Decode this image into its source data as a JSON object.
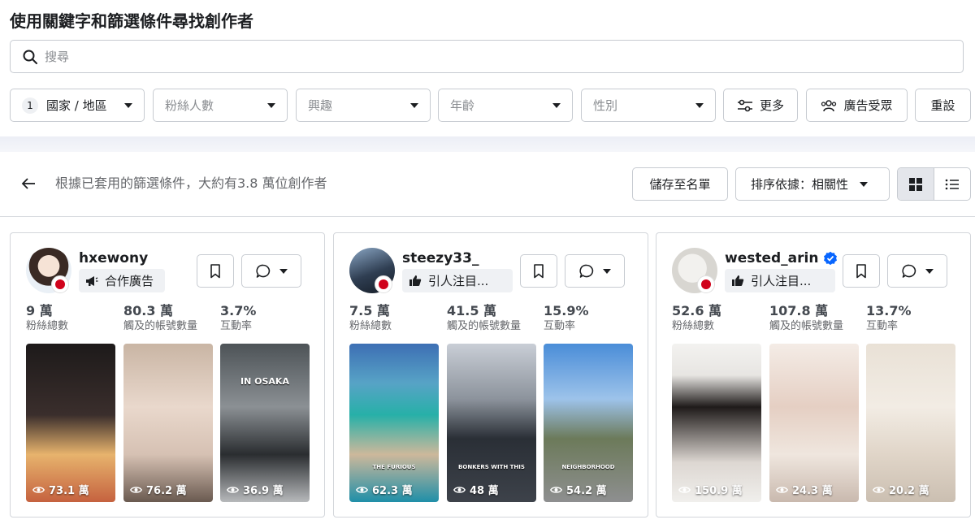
{
  "page": {
    "title": "使用關鍵字和篩選條件尋找創作者"
  },
  "search": {
    "placeholder": "搜尋"
  },
  "filters": {
    "country_count": "1",
    "country": "國家 / 地區",
    "followers": "粉絲人數",
    "interests": "興趣",
    "age": "年齡",
    "gender": "性別",
    "more": "更多",
    "audience": "廣告受眾",
    "reset": "重設"
  },
  "results": {
    "summary": "根據已套用的篩選條件，大約有3.8 萬位創作者",
    "save_list": "儲存至名單",
    "sort": "排序依據：相關性"
  },
  "colors": {
    "accent": "#0866ff",
    "flag": "#d0021b",
    "border": "#c7cbd1"
  },
  "creators": [
    {
      "handle": "hxewony",
      "verified": false,
      "tag": "合作廣告",
      "tag_icon": "megaphone-icon",
      "followers": "9 萬",
      "followers_label": "粉絲總數",
      "reach": "80.3 萬",
      "reach_label": "觸及的帳號數量",
      "engagement": "3.7%",
      "engagement_label": "互動率",
      "videos": [
        {
          "views": "73.1 萬",
          "caption": ""
        },
        {
          "views": "76.2 萬",
          "caption": ""
        },
        {
          "views": "36.9 萬",
          "caption": "IN OSAKA"
        }
      ]
    },
    {
      "handle": "steezy33_",
      "verified": false,
      "tag": "引人注目...",
      "tag_icon": "thumbs-up-icon",
      "followers": "7.5 萬",
      "followers_label": "粉絲總數",
      "reach": "41.5 萬",
      "reach_label": "觸及的帳號數量",
      "engagement": "15.9%",
      "engagement_label": "互動率",
      "videos": [
        {
          "views": "62.3 萬",
          "caption": "THE FURIOUS"
        },
        {
          "views": "48 萬",
          "caption": "BONKERS WITH THIS"
        },
        {
          "views": "54.2 萬",
          "caption": "NEIGHBORHOOD"
        }
      ]
    },
    {
      "handle": "wested_arin",
      "verified": true,
      "tag": "引人注目...",
      "tag_icon": "thumbs-up-icon",
      "followers": "52.6 萬",
      "followers_label": "粉絲總數",
      "reach": "107.8 萬",
      "reach_label": "觸及的帳號數量",
      "engagement": "13.7%",
      "engagement_label": "互動率",
      "videos": [
        {
          "views": "150.9 萬",
          "caption": ""
        },
        {
          "views": "24.3 萬",
          "caption": ""
        },
        {
          "views": "20.2 萬",
          "caption": ""
        }
      ]
    }
  ]
}
